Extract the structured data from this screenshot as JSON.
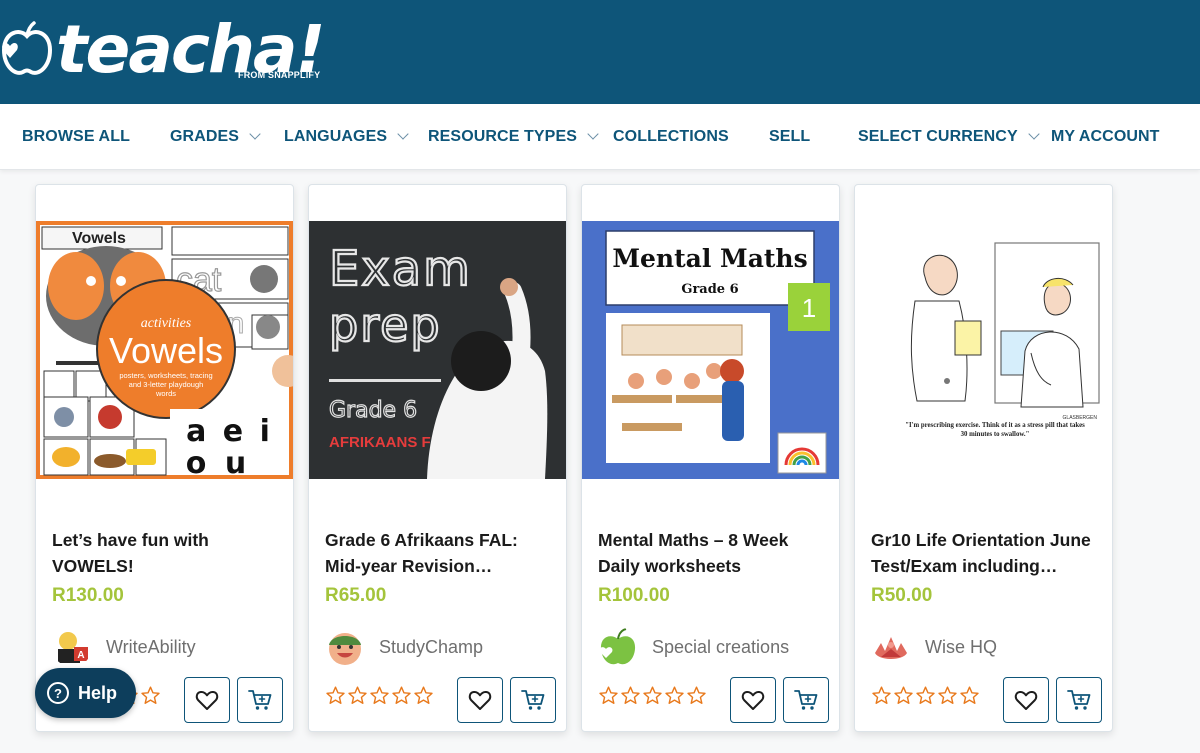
{
  "brand": {
    "logo_text": "teacha!",
    "sub_text": "FROM SNAPPLIFY"
  },
  "nav": [
    {
      "label": "BROWSE ALL",
      "dropdown": false
    },
    {
      "label": "GRADES",
      "dropdown": true
    },
    {
      "label": "LANGUAGES",
      "dropdown": true
    },
    {
      "label": "RESOURCE TYPES",
      "dropdown": true
    },
    {
      "label": "COLLECTIONS",
      "dropdown": false
    },
    {
      "label": "SELL",
      "dropdown": false
    },
    {
      "label": "SELECT CURRENCY",
      "dropdown": true
    },
    {
      "label": "MY ACCOUNT",
      "dropdown": false
    }
  ],
  "products": [
    {
      "title": "Let’s have fun with VOWELS!",
      "price": "R130.00",
      "seller": "WriteAbility",
      "rating": 0,
      "thumb": {
        "label_top": "Vowels",
        "circle_small": "activities",
        "circle_big": "Vowels",
        "circle_desc": "posters, worksheets, tracing and 3-letter playdough words",
        "letters_row1": "a e i",
        "letters_row2": "o u",
        "word": "cat",
        "word2": "man"
      }
    },
    {
      "title": "Grade 6 Afrikaans FAL: Mid-year Revision…",
      "price": "R65.00",
      "seller": "StudyChamp",
      "rating": 0,
      "thumb": {
        "line1": "Exam",
        "line2": "prep",
        "grade": "Grade 6",
        "subject": "AFRIKAANS FAL"
      }
    },
    {
      "title": "Mental Maths – 8 Week Daily worksheets",
      "price": "R100.00",
      "seller": "Special creations",
      "rating": 0,
      "thumb": {
        "heading": "Mental Maths",
        "grade": "Grade 6",
        "badge": "1"
      }
    },
    {
      "title": "Gr10 Life Orientation June Test/Exam including…",
      "price": "R50.00",
      "seller": "Wise HQ",
      "rating": 0,
      "thumb": {
        "caption": "\"I'm prescribing exercise. Think of it as a stress pill that takes 30 minutes to swallow.\"",
        "signature": "GLASBERGEN"
      }
    }
  ],
  "help": {
    "label": "Help",
    "icon": "question-icon"
  },
  "colors": {
    "brand": "#0e5579",
    "price": "#a4c43b",
    "star": "#e8791c",
    "help_bg": "#0d3e5c"
  }
}
